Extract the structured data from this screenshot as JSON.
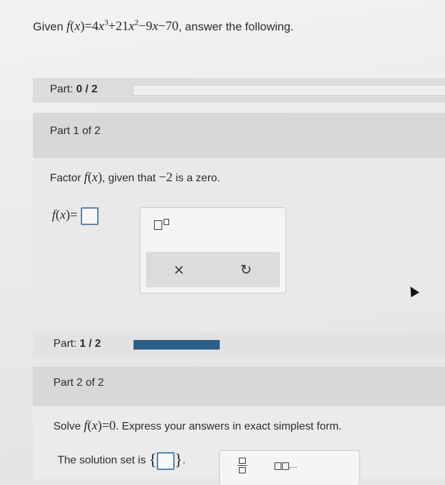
{
  "question": {
    "given_label": "Given",
    "function_name": "f",
    "variable": "x",
    "suffix": ", answer the following."
  },
  "part_progress_1": {
    "label": "Part:",
    "value": "0 / 2",
    "fraction": 0.0
  },
  "part1": {
    "heading": "Part 1 of 2",
    "instruction_pre": "Factor",
    "instruction_post": ", given that",
    "zero_value": "−2",
    "instruction_end": "is a zero.",
    "answer_label": "f(x) ="
  },
  "toolbox": {
    "exponent_icon": "exponent-template-icon",
    "clear_icon": "clear-x-icon",
    "undo_icon": "undo-icon",
    "clear_symbol": "×",
    "undo_symbol": "↻"
  },
  "part_progress_2": {
    "label": "Part:",
    "value": "1 / 2",
    "fraction": 0.5,
    "color": "#2b5f8a"
  },
  "part2": {
    "heading": "Part 2 of 2",
    "instruction_pre": "Solve",
    "instruction_post": ". Express your answers in exact simplest form.",
    "equation": "f(x) = 0",
    "solution_label": "The solution set is"
  },
  "toolbox2": {
    "fraction_icon": "fraction-template-icon",
    "list_icon": "comma-list-template-icon",
    "list_symbol": ",..."
  }
}
